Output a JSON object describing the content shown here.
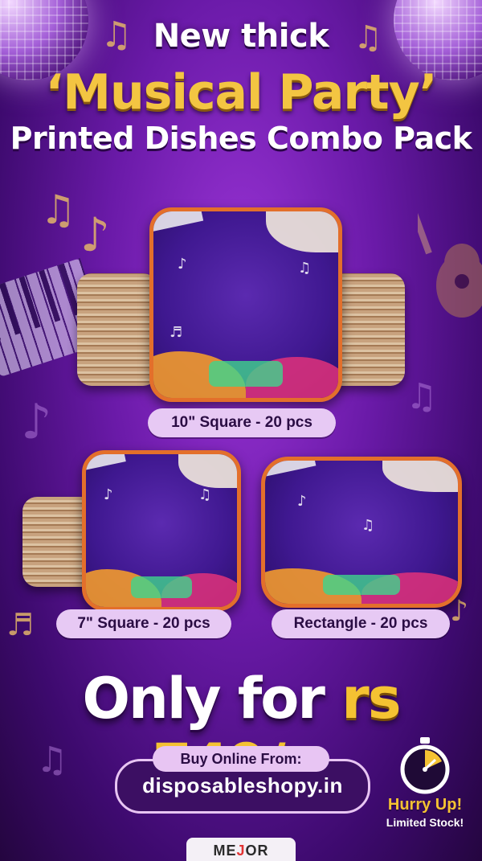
{
  "headline": {
    "line1": "New thick",
    "line2": "‘Musical Party’",
    "line3": "Printed Dishes Combo Pack"
  },
  "products": [
    {
      "label": "10\" Square - 20 pcs"
    },
    {
      "label": "7\" Square - 20 pcs"
    },
    {
      "label": "Rectangle - 20 pcs"
    }
  ],
  "price": {
    "prefix": "Only for",
    "amount": "rs 749/="
  },
  "buy": {
    "label": "Buy Online From:",
    "url": "disposableshopy.in"
  },
  "urgency": {
    "line1": "Hurry Up!",
    "line2": "Limited Stock!"
  },
  "brand": {
    "part1": "ME",
    "part2": "J",
    "part3": "OR"
  },
  "colors": {
    "background": "#6a1aa8",
    "gold": "#f3c542",
    "pill": "#e7c9f4",
    "plate_rim": "#e36f2b"
  },
  "icons": [
    "disco-ball-icon",
    "music-note-icon",
    "piano-icon",
    "guitar-icon",
    "stopwatch-icon"
  ]
}
